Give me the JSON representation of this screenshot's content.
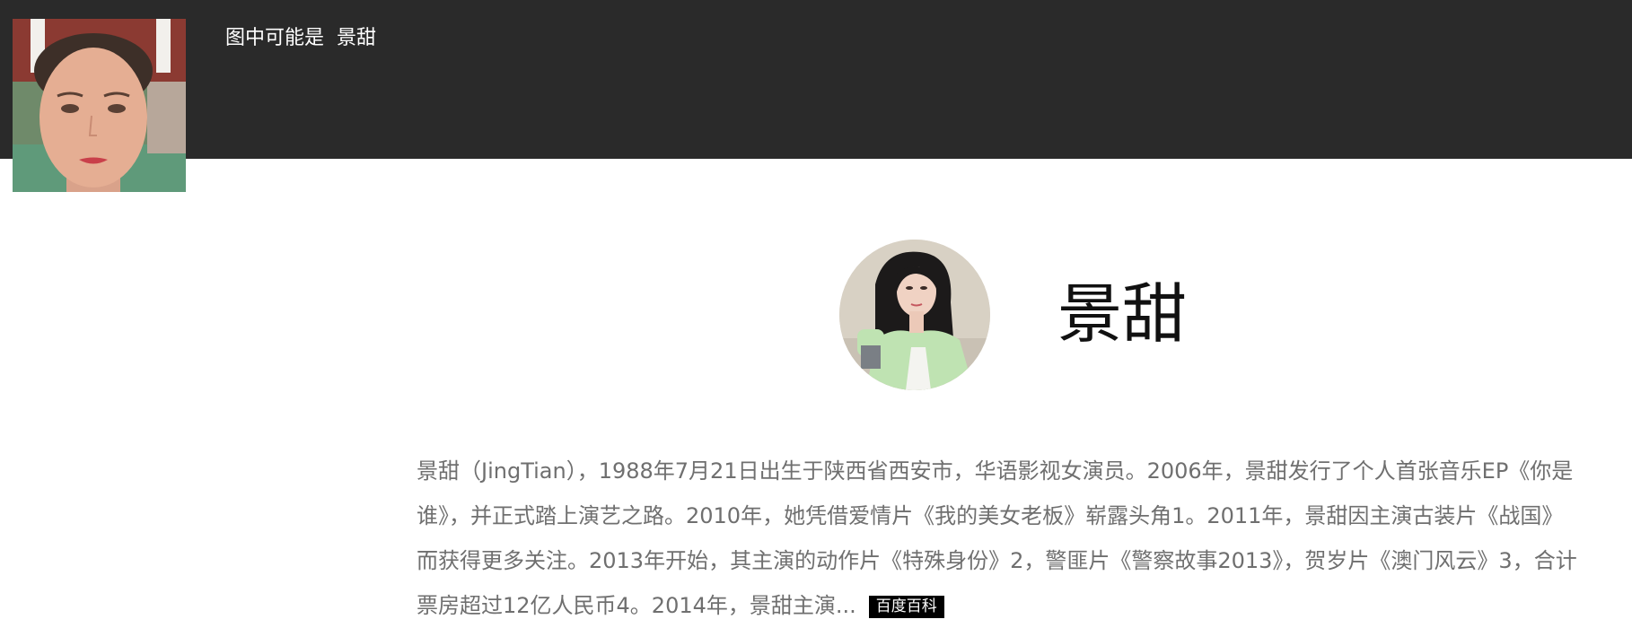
{
  "header": {
    "caption_prefix": "图中可能是",
    "caption_name": "景甜"
  },
  "query_image": {
    "icon": "face-photo"
  },
  "entity": {
    "name": "景甜",
    "avatar_icon": "portrait-photo",
    "description": "景甜（JingTian），1988年7月21日出生于陕西省西安市，华语影视女演员。2006年，景甜发行了个人首张音乐EP《你是谁》，并正式踏上演艺之路。2010年，她凭借爱情片《我的美女老板》崭露头角1。2011年，景甜因主演古装片《战国》而获得更多关注。2013年开始，其主演的动作片《特殊身份》2，警匪片《警察故事2013》，贺岁片《澳门风云》3，合计票房超过12亿人民币4。2014年，景甜主演...",
    "source_label": "百度百科"
  },
  "colors": {
    "topbar": "#2a2a2a",
    "bio_text": "#6f6f6f",
    "badge_bg": "#000000"
  }
}
